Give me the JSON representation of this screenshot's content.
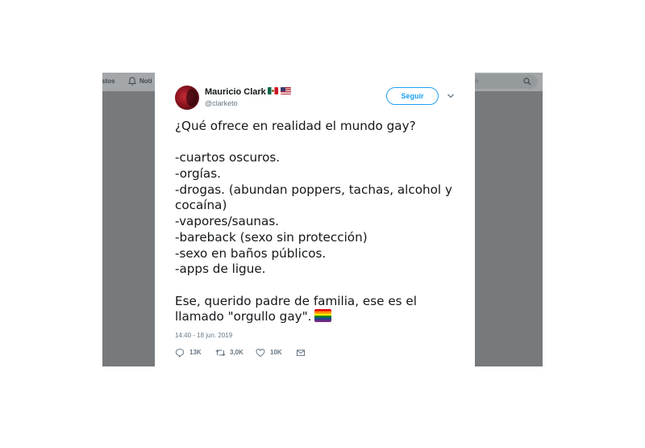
{
  "background_nav": {
    "left_tab_fragment": "stos",
    "notifications_fragment": "Noti",
    "search_fragment": "e"
  },
  "tweet": {
    "display_name": "Mauricio Clark",
    "handle": "@clarketo",
    "follow_label": "Seguir",
    "lines": [
      "¿Qué ofrece en realidad el mundo gay?",
      "",
      "-cuartos oscuros.",
      "-orgías.",
      "-drogas. (abundan poppers, tachas, alcohol y",
      "cocaína)",
      "-vapores/saunas.",
      "-bareback (sexo sin protección)",
      "-sexo en baños públicos.",
      "-apps de ligue.",
      "",
      "Ese, querido padre de familia, ese es el",
      "llamado \"orgullo gay\"."
    ],
    "timestamp": "14:40 - 18 jun. 2019",
    "reply_count": "13K",
    "retweet_count": "3,0K",
    "like_count": "10K",
    "name_flags": [
      "mexico-flag",
      "usa-flag"
    ],
    "text_emoji": "rainbow-flag"
  },
  "colors": {
    "accent": "#1da1f2",
    "text_primary": "#14171a",
    "text_secondary": "#657786",
    "dim_overlay": "#767a7c"
  }
}
